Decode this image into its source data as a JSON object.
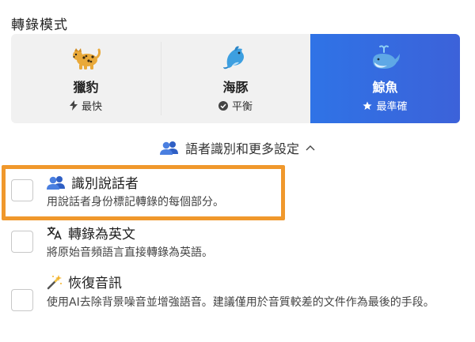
{
  "section_title": "轉錄模式",
  "modes": [
    {
      "emoji": "leopard",
      "name": "獵豹",
      "sub_icon": "bolt-icon",
      "sub": "最快",
      "selected": false
    },
    {
      "emoji": "dolphin",
      "name": "海豚",
      "sub_icon": "check-circle-icon",
      "sub": "平衡",
      "selected": false
    },
    {
      "emoji": "whale",
      "name": "鯨魚",
      "sub_icon": "star-icon",
      "sub": "最準確",
      "selected": true
    }
  ],
  "advanced_toggle": {
    "label": "語者識別和更多設定",
    "expanded": true
  },
  "options": [
    {
      "icon": "people-icon",
      "title": "識別說話者",
      "desc": "用說話者身份標記轉錄的每個部分。",
      "checked": false
    },
    {
      "icon": "translate-icon",
      "title": "轉錄為英文",
      "desc": "將原始音頻語言直接轉錄為英語。",
      "checked": false
    },
    {
      "icon": "magic-wand-icon",
      "title": "恢復音訊",
      "desc": "使用AI去除背景噪音並增強語音。建議僅用於音質較差的文件作為最後的手段。",
      "checked": false
    }
  ],
  "colors": {
    "selected_mode": "#3468e0",
    "highlight": "#f0982c",
    "people_icon": "#3a6fd8"
  }
}
